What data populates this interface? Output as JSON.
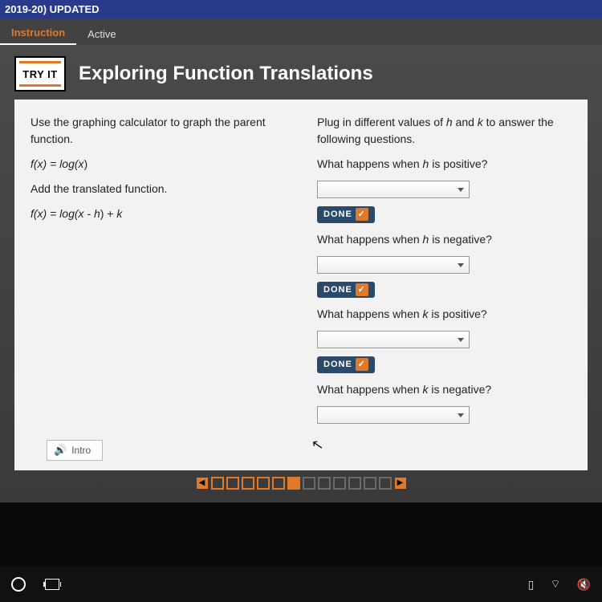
{
  "banner": {
    "text": "2019-20) UPDATED"
  },
  "tabs": {
    "instruction": "Instruction",
    "active": "Active"
  },
  "tryit": {
    "badge": "TRY IT",
    "title": "Exploring Function Translations"
  },
  "left": {
    "p1": "Use the graphing calculator to graph the parent function.",
    "eq1_pre": "f(x) = log(",
    "eq1_var": "x",
    "eq1_post": ")",
    "p2": "Add the translated function.",
    "eq2_pre": "f(x) = log(",
    "eq2_xmh": "x - h",
    "eq2_post": ") + ",
    "eq2_k": "k"
  },
  "right": {
    "intro1": "Plug in different values of ",
    "h": "h",
    "and": " and ",
    "k": "k",
    "intro2": " to answer the following questions.",
    "q1a": "What happens when ",
    "q1b": " is positive?",
    "q2a": "What happens when ",
    "q2b": " is negative?",
    "q3a": "What happens when ",
    "q3b": " is positive?",
    "q4a": "What happens when ",
    "q4b": " is negative?",
    "done": "DONE"
  },
  "intro_btn": "Intro",
  "pager": {
    "total": 12,
    "current": 6
  },
  "tray": {
    "battery": "▭",
    "wifi": "⌔",
    "volume": "⫢×"
  }
}
